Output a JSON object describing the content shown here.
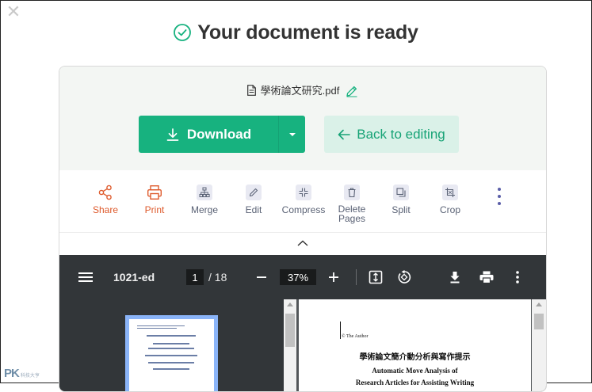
{
  "modal": {
    "close_label": "✕",
    "title": "Your document is ready"
  },
  "file": {
    "name": "學術論文研究.pdf"
  },
  "buttons": {
    "download": "Download",
    "back": "Back to editing"
  },
  "tools": [
    {
      "label": "Share",
      "icon": "share-icon",
      "color": "#de5a2c"
    },
    {
      "label": "Print",
      "icon": "printer-icon",
      "color": "#de5a2c"
    },
    {
      "label": "Merge",
      "icon": "merge-icon"
    },
    {
      "label": "Edit",
      "icon": "edit-icon"
    },
    {
      "label": "Compress",
      "icon": "compress-icon"
    },
    {
      "label": "Delete Pages",
      "icon": "trash-icon"
    },
    {
      "label": "Split",
      "icon": "split-icon"
    },
    {
      "label": "Crop",
      "icon": "crop-icon"
    }
  ],
  "viewer": {
    "doc_name": "1021-ed",
    "current_page": "1",
    "total_pages": "/ 18",
    "zoom": "37%"
  },
  "page_preview": {
    "line_small": "© The Author",
    "title_zh": "學術論文簡介動分析與寫作提示",
    "title_en_1": "Automatic Move Analysis of",
    "title_en_2": "Research Articles for Assisting Writing"
  },
  "watermark": {
    "text": "PK",
    "sub": "科技大亨"
  },
  "colors": {
    "accent": "#17b27f",
    "accent_light": "#daf1e8",
    "orange": "#de5a2c",
    "viewer_dark": "#323639"
  }
}
